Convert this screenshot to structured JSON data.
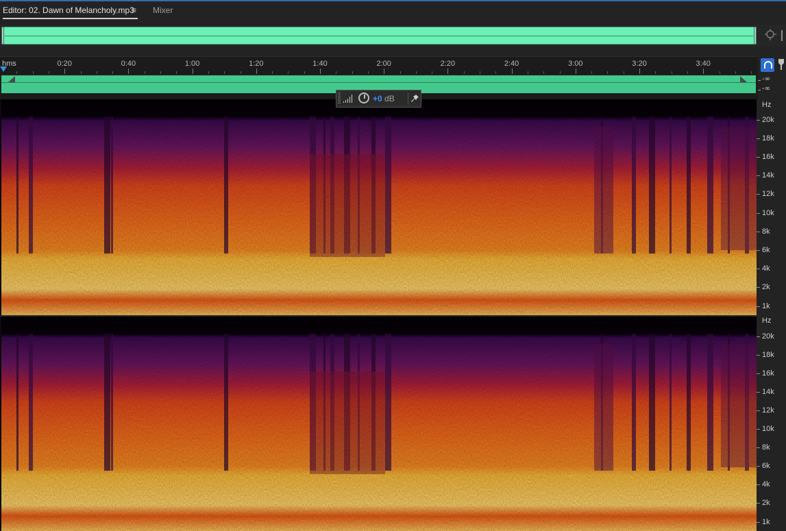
{
  "tabs": {
    "editor_label": "Editor: 02. Dawn of Melancholy.mp3",
    "menu_icon": "≡",
    "mixer_label": "Mixer"
  },
  "ruler": {
    "unit": "hms",
    "ticks": [
      "0:20",
      "0:40",
      "1:00",
      "1:20",
      "1:40",
      "2:00",
      "2:20",
      "2:40",
      "3:00",
      "3:20",
      "3:40"
    ]
  },
  "levels": {
    "top": "-∞",
    "bottom": "-∞"
  },
  "hud": {
    "db_value": "+0",
    "db_unit": "dB"
  },
  "frequency_scale": {
    "unit": "Hz",
    "labels": [
      "20k",
      "18k",
      "16k",
      "14k",
      "12k",
      "10k",
      "8k",
      "6k",
      "4k",
      "2k",
      "1k"
    ]
  },
  "colors": {
    "accent": "#2e6fa8",
    "overview": "#6cf0b6",
    "range": "#44c98c",
    "hud_value": "#3f8fff"
  },
  "icons": {
    "tab_menu": "hamburger-menu-icon",
    "zoom": "zoom-crosshair-icon",
    "snap": "magnet-snap-icon",
    "marker": "marker-pin-icon",
    "volume": "volume-bars-icon",
    "knob": "volume-knob-icon",
    "pin": "pin-icon"
  }
}
